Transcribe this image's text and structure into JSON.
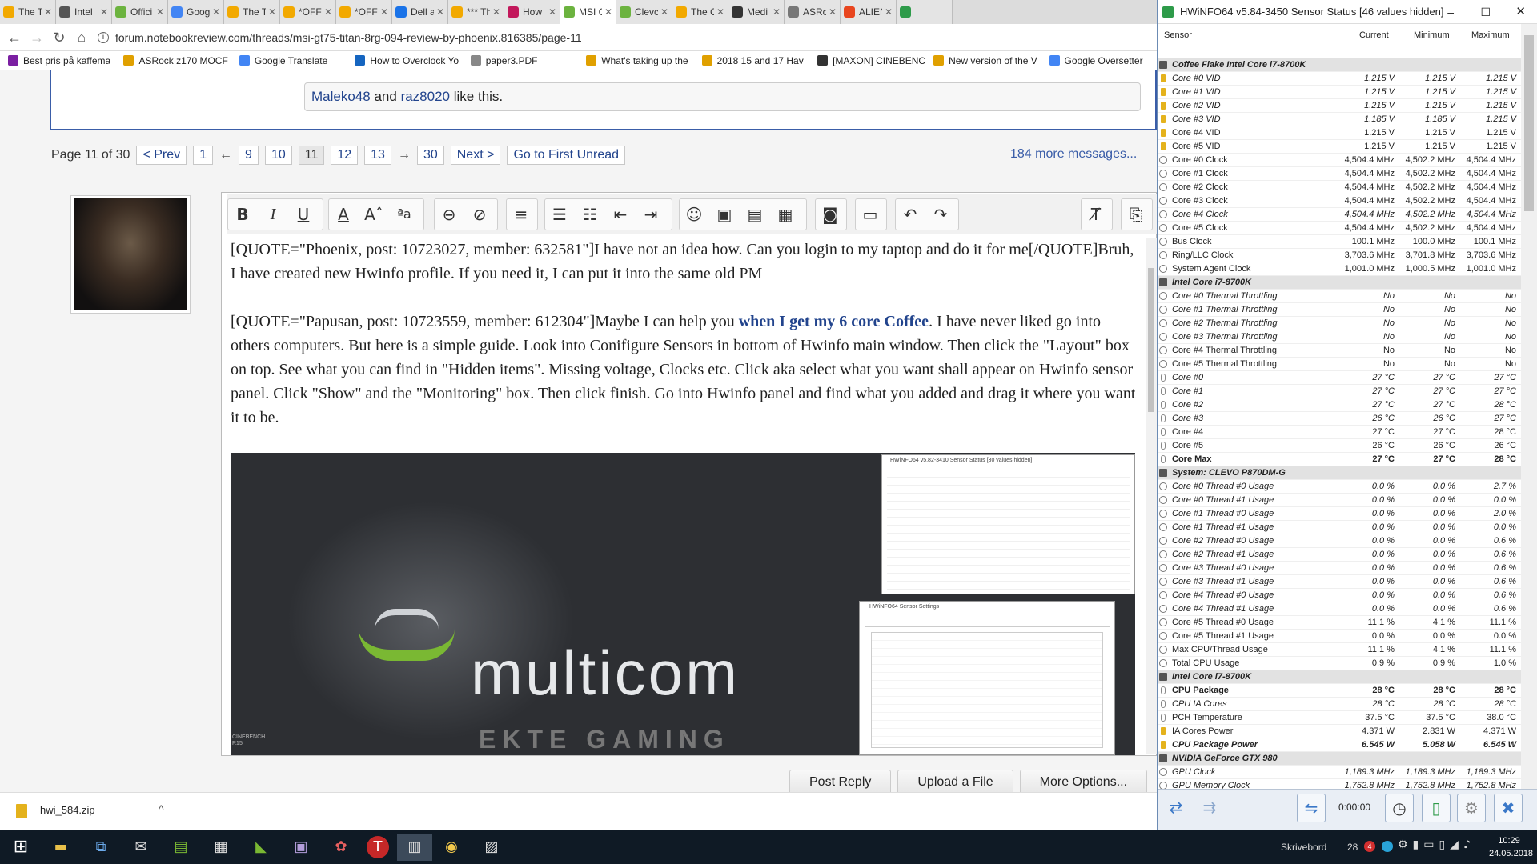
{
  "browser": {
    "tabs": [
      {
        "title": "The T",
        "color": "#f2a900"
      },
      {
        "title": "Intel",
        "color": "#555"
      },
      {
        "title": "Offici",
        "color": "#6cb33f"
      },
      {
        "title": "Goog",
        "color": "#4285f4"
      },
      {
        "title": "The T",
        "color": "#f2a900"
      },
      {
        "title": "*OFFI",
        "color": "#f2a900"
      },
      {
        "title": "*OFFI",
        "color": "#f2a900"
      },
      {
        "title": "Dell a",
        "color": "#1a73e8"
      },
      {
        "title": "*** Th",
        "color": "#f2a900"
      },
      {
        "title": "How",
        "color": "#c2185b"
      },
      {
        "title": "MSI G",
        "color": "#6cb33f"
      },
      {
        "title": "Clevc",
        "color": "#6cb33f"
      },
      {
        "title": "The C",
        "color": "#f2a900"
      },
      {
        "title": "Medi",
        "color": "#333"
      },
      {
        "title": "ASRo",
        "color": "#777"
      },
      {
        "title": "ALIEN",
        "color": "#e8451e"
      },
      {
        "title": "",
        "color": "#2e9b4a"
      }
    ],
    "active_tab_index": 10,
    "url": "forum.notebookreview.com/threads/msi-gt75-titan-8rg-094-review-by-phoenix.816385/page-11",
    "bookmarks": [
      {
        "label": "Best pris på kaffema",
        "color": "#7b1fa2"
      },
      {
        "label": "ASRock z170 MOCF",
        "color": "#e0a000"
      },
      {
        "label": "Google Translate",
        "color": "#4285f4"
      },
      {
        "label": "How to Overclock Yo",
        "color": "#1565c0"
      },
      {
        "label": "paper3.PDF",
        "color": "#888"
      },
      {
        "label": "What's taking up the",
        "color": "#e0a000"
      },
      {
        "label": "2018 15 and 17 Hav",
        "color": "#e0a000"
      },
      {
        "label": "[MAXON] CINEBENC",
        "color": "#333"
      },
      {
        "label": "New version of the V",
        "color": "#e0a000"
      },
      {
        "label": "Google Oversetter",
        "color": "#4285f4"
      }
    ]
  },
  "forum": {
    "likes_users": [
      "Maleko48",
      "raz8020"
    ],
    "likes_text": "and",
    "likes_suffix": "like this.",
    "pager": {
      "label": "Page 11 of 30",
      "prev": "< Prev",
      "pages": [
        "1",
        "←",
        "9",
        "10",
        "11",
        "12",
        "13",
        "→",
        "30"
      ],
      "next": "Next >",
      "first_unread": "Go to First Unread",
      "more": "184 more messages..."
    },
    "editor": {
      "p1": "[QUOTE=\"Phoenix, post: 10723027, member: 632581\"]I have not an idea how. Can you login to my taptop and do it for me[/QUOTE]Bruh, I have created new Hwinfo profile. If you need it, I can put it into the same old PM",
      "p2_a": "[QUOTE=\"Papusan, post: 10723559, member: 612304\"]Maybe I can help you ",
      "p2_link": "when I get my 6 core Coffee",
      "p2_b": ". I have never liked go into others computers. But here is a simple guide. Look into Conifigure Sensors in bottom of Hwinfo main window. Then click the \"Layout\" box on top. See what you can find in \"Hidden items\". Missing voltage, Clocks etc.  Click aka select what you want shall appear on Hwinfo sensor panel. Click \"Show\" and the \"Monitoring\" box. Then click finish. Go into Hwinfo panel and find what you added and drag it where you want it to be.",
      "embed_logo": "multicom",
      "embed_sub": "EKTE GAMING",
      "embed_cinebench": "CINEBENCH R15",
      "embed_win_title": "HWiNFO64 v5.82-3410 Sensor Status [30 values hidden]",
      "embed_settings_title": "HWiNFO64 Sensor Settings"
    },
    "buttons": [
      "Post Reply",
      "Upload a File",
      "More Options..."
    ]
  },
  "download": {
    "file": "hwi_584.zip"
  },
  "taskbar": {
    "desktop_label": "Skrivebord",
    "temp": "28",
    "time": "10:29",
    "date": "24.05.2018"
  },
  "hwinfo": {
    "title": "HWiNFO64 v5.84-3450 Sensor Status [46 values hidden]",
    "columns": [
      "Sensor",
      "Current",
      "Minimum",
      "Maximum"
    ],
    "elapsed": "0:00:00",
    "rows": [
      {
        "t": "sec",
        "n": "Coffee Flake Intel Core i7-8700K"
      },
      {
        "i": "y",
        "s": "it",
        "n": "Core #0 VID",
        "c": "1.215 V",
        "mi": "1.215 V",
        "ma": "1.215 V"
      },
      {
        "i": "y",
        "s": "it",
        "n": "Core #1 VID",
        "c": "1.215 V",
        "mi": "1.215 V",
        "ma": "1.215 V"
      },
      {
        "i": "y",
        "s": "it",
        "n": "Core #2 VID",
        "c": "1.215 V",
        "mi": "1.215 V",
        "ma": "1.215 V"
      },
      {
        "i": "y",
        "s": "it",
        "n": "Core #3 VID",
        "c": "1.185 V",
        "mi": "1.185 V",
        "ma": "1.215 V"
      },
      {
        "i": "y",
        "n": "Core #4 VID",
        "c": "1.215 V",
        "mi": "1.215 V",
        "ma": "1.215 V"
      },
      {
        "i": "y",
        "n": "Core #5 VID",
        "c": "1.215 V",
        "mi": "1.215 V",
        "ma": "1.215 V"
      },
      {
        "i": "c",
        "n": "Core #0 Clock",
        "c": "4,504.4 MHz",
        "mi": "4,502.2 MHz",
        "ma": "4,504.4 MHz"
      },
      {
        "i": "c",
        "n": "Core #1 Clock",
        "c": "4,504.4 MHz",
        "mi": "4,502.2 MHz",
        "ma": "4,504.4 MHz"
      },
      {
        "i": "c",
        "n": "Core #2 Clock",
        "c": "4,504.4 MHz",
        "mi": "4,502.2 MHz",
        "ma": "4,504.4 MHz"
      },
      {
        "i": "c",
        "n": "Core #3 Clock",
        "c": "4,504.4 MHz",
        "mi": "4,502.2 MHz",
        "ma": "4,504.4 MHz"
      },
      {
        "i": "c",
        "s": "it",
        "n": "Core #4 Clock",
        "c": "4,504.4 MHz",
        "mi": "4,502.2 MHz",
        "ma": "4,504.4 MHz"
      },
      {
        "i": "c",
        "n": "Core #5 Clock",
        "c": "4,504.4 MHz",
        "mi": "4,502.2 MHz",
        "ma": "4,504.4 MHz"
      },
      {
        "i": "c",
        "n": "Bus Clock",
        "c": "100.1 MHz",
        "mi": "100.0 MHz",
        "ma": "100.1 MHz"
      },
      {
        "i": "c",
        "n": "Ring/LLC Clock",
        "c": "3,703.6 MHz",
        "mi": "3,701.8 MHz",
        "ma": "3,703.6 MHz"
      },
      {
        "i": "c",
        "n": "System Agent Clock",
        "c": "1,001.0 MHz",
        "mi": "1,000.5 MHz",
        "ma": "1,001.0 MHz"
      },
      {
        "t": "sec",
        "n": "Intel Core i7-8700K"
      },
      {
        "i": "c",
        "s": "it",
        "n": "Core #0 Thermal Throttling",
        "c": "No",
        "mi": "No",
        "ma": "No"
      },
      {
        "i": "c",
        "s": "it",
        "n": "Core #1 Thermal Throttling",
        "c": "No",
        "mi": "No",
        "ma": "No"
      },
      {
        "i": "c",
        "s": "it",
        "n": "Core #2 Thermal Throttling",
        "c": "No",
        "mi": "No",
        "ma": "No"
      },
      {
        "i": "c",
        "s": "it",
        "n": "Core #3 Thermal Throttling",
        "c": "No",
        "mi": "No",
        "ma": "No"
      },
      {
        "i": "c",
        "n": "Core #4 Thermal Throttling",
        "c": "No",
        "mi": "No",
        "ma": "No"
      },
      {
        "i": "c",
        "n": "Core #5 Thermal Throttling",
        "c": "No",
        "mi": "No",
        "ma": "No"
      },
      {
        "i": "t",
        "s": "it",
        "n": "Core #0",
        "c": "27 °C",
        "mi": "27 °C",
        "ma": "27 °C"
      },
      {
        "i": "t",
        "s": "it",
        "n": "Core #1",
        "c": "27 °C",
        "mi": "27 °C",
        "ma": "27 °C"
      },
      {
        "i": "t",
        "s": "it",
        "n": "Core #2",
        "c": "27 °C",
        "mi": "27 °C",
        "ma": "28 °C"
      },
      {
        "i": "t",
        "s": "it",
        "n": "Core #3",
        "c": "26 °C",
        "mi": "26 °C",
        "ma": "27 °C"
      },
      {
        "i": "t",
        "n": "Core #4",
        "c": "27 °C",
        "mi": "27 °C",
        "ma": "28 °C"
      },
      {
        "i": "t",
        "n": "Core #5",
        "c": "26 °C",
        "mi": "26 °C",
        "ma": "26 °C"
      },
      {
        "i": "t",
        "s": "b",
        "n": "Core Max",
        "c": "27 °C",
        "mi": "27 °C",
        "ma": "28 °C"
      },
      {
        "t": "sec",
        "n": "System: CLEVO P870DM-G"
      },
      {
        "i": "c",
        "s": "it",
        "n": "Core #0 Thread #0 Usage",
        "c": "0.0 %",
        "mi": "0.0 %",
        "ma": "2.7 %"
      },
      {
        "i": "c",
        "s": "it",
        "n": "Core #0 Thread #1 Usage",
        "c": "0.0 %",
        "mi": "0.0 %",
        "ma": "0.0 %"
      },
      {
        "i": "c",
        "s": "it",
        "n": "Core #1 Thread #0 Usage",
        "c": "0.0 %",
        "mi": "0.0 %",
        "ma": "2.0 %"
      },
      {
        "i": "c",
        "s": "it",
        "n": "Core #1 Thread #1 Usage",
        "c": "0.0 %",
        "mi": "0.0 %",
        "ma": "0.0 %"
      },
      {
        "i": "c",
        "s": "it",
        "n": "Core #2 Thread #0 Usage",
        "c": "0.0 %",
        "mi": "0.0 %",
        "ma": "0.6 %"
      },
      {
        "i": "c",
        "s": "it",
        "n": "Core #2 Thread #1 Usage",
        "c": "0.0 %",
        "mi": "0.0 %",
        "ma": "0.6 %"
      },
      {
        "i": "c",
        "s": "it",
        "n": "Core #3 Thread #0 Usage",
        "c": "0.0 %",
        "mi": "0.0 %",
        "ma": "0.6 %"
      },
      {
        "i": "c",
        "s": "it",
        "n": "Core #3 Thread #1 Usage",
        "c": "0.0 %",
        "mi": "0.0 %",
        "ma": "0.6 %"
      },
      {
        "i": "c",
        "s": "it",
        "n": "Core #4 Thread #0 Usage",
        "c": "0.0 %",
        "mi": "0.0 %",
        "ma": "0.6 %"
      },
      {
        "i": "c",
        "s": "it",
        "n": "Core #4 Thread #1 Usage",
        "c": "0.0 %",
        "mi": "0.0 %",
        "ma": "0.6 %"
      },
      {
        "i": "c",
        "n": "Core #5 Thread #0 Usage",
        "c": "11.1 %",
        "mi": "4.1 %",
        "ma": "11.1 %"
      },
      {
        "i": "c",
        "n": "Core #5 Thread #1 Usage",
        "c": "0.0 %",
        "mi": "0.0 %",
        "ma": "0.0 %"
      },
      {
        "i": "c",
        "n": "Max CPU/Thread Usage",
        "c": "11.1 %",
        "mi": "4.1 %",
        "ma": "11.1 %"
      },
      {
        "i": "c",
        "n": "Total CPU Usage",
        "c": "0.9 %",
        "mi": "0.9 %",
        "ma": "1.0 %"
      },
      {
        "t": "sec",
        "n": "Intel Core i7-8700K"
      },
      {
        "i": "t",
        "s": "b",
        "n": "CPU Package",
        "c": "28 °C",
        "mi": "28 °C",
        "ma": "28 °C"
      },
      {
        "i": "t",
        "s": "it",
        "n": "CPU IA Cores",
        "c": "28 °C",
        "mi": "28 °C",
        "ma": "28 °C"
      },
      {
        "i": "t",
        "n": "PCH Temperature",
        "c": "37.5 °C",
        "mi": "37.5 °C",
        "ma": "38.0 °C"
      },
      {
        "i": "y",
        "n": "IA Cores Power",
        "c": "4.371 W",
        "mi": "2.831 W",
        "ma": "4.371 W"
      },
      {
        "i": "y",
        "s": "bi",
        "n": "CPU Package Power",
        "c": "6.545 W",
        "mi": "5.058 W",
        "ma": "6.545 W"
      },
      {
        "t": "sec",
        "n": "NVIDIA GeForce GTX 980"
      },
      {
        "i": "c",
        "s": "it",
        "n": "GPU Clock",
        "c": "1,189.3 MHz",
        "mi": "1,189.3 MHz",
        "ma": "1,189.3 MHz"
      },
      {
        "i": "c",
        "s": "it",
        "n": "GPU Memory Clock",
        "c": "1,752.8 MHz",
        "mi": "1,752.8 MHz",
        "ma": "1,752.8 MHz"
      }
    ]
  }
}
